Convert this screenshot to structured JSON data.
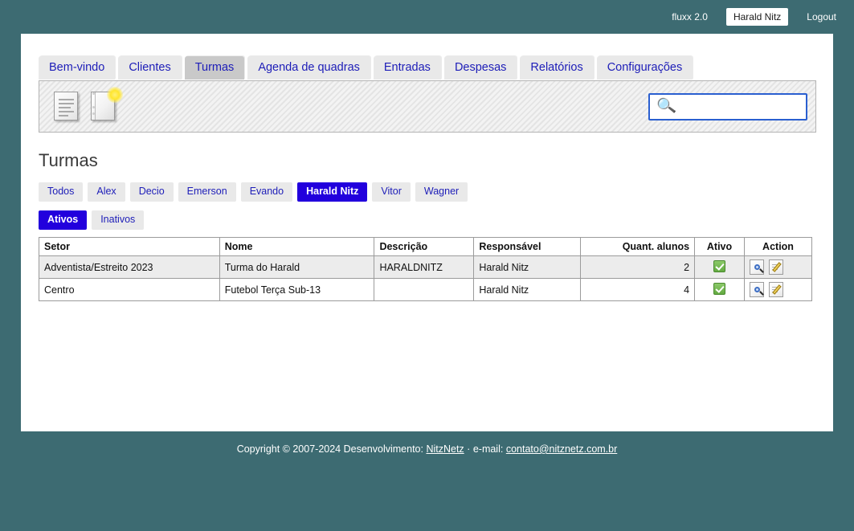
{
  "topbar": {
    "brand": "fluxx 2.0",
    "user": "Harald Nitz",
    "logout": "Logout"
  },
  "tabs": [
    {
      "label": "Bem-vindo",
      "active": false
    },
    {
      "label": "Clientes",
      "active": false
    },
    {
      "label": "Turmas",
      "active": true
    },
    {
      "label": "Agenda de quadras",
      "active": false
    },
    {
      "label": "Entradas",
      "active": false
    },
    {
      "label": "Despesas",
      "active": false
    },
    {
      "label": "Relatórios",
      "active": false
    },
    {
      "label": "Configurações",
      "active": false
    }
  ],
  "toolbar": {
    "list_icon": "document-list-icon",
    "new_icon": "new-document-icon"
  },
  "search": {
    "value": "",
    "placeholder": "",
    "icon": "search-icon"
  },
  "page": {
    "title": "Turmas"
  },
  "filters": {
    "people": [
      {
        "label": "Todos",
        "active": false
      },
      {
        "label": "Alex",
        "active": false
      },
      {
        "label": "Decio",
        "active": false
      },
      {
        "label": "Emerson",
        "active": false
      },
      {
        "label": "Evando",
        "active": false
      },
      {
        "label": "Harald Nitz",
        "active": true
      },
      {
        "label": "Vitor",
        "active": false
      },
      {
        "label": "Wagner",
        "active": false
      }
    ],
    "status": [
      {
        "label": "Ativos",
        "active": true
      },
      {
        "label": "Inativos",
        "active": false
      }
    ]
  },
  "table": {
    "columns": [
      "Setor",
      "Nome",
      "Descrição",
      "Responsável",
      "Quant. alunos",
      "Ativo",
      "Action"
    ],
    "rows": [
      {
        "setor": "Adventista/Estreito 2023",
        "nome": "Turma do Harald",
        "descricao": "HARALDNITZ",
        "responsavel": "Harald Nitz",
        "quant_alunos": "2",
        "ativo": true
      },
      {
        "setor": "Centro",
        "nome": "Futebol Terça Sub-13",
        "descricao": "",
        "responsavel": "Harald Nitz",
        "quant_alunos": "4",
        "ativo": true
      }
    ]
  },
  "footer": {
    "copyright": "Copyright © 2007-2024 Desenvolvimento:",
    "dev_link": "NitzNetz",
    "separator": "·",
    "email_label": "e-mail:",
    "email_link": "contato@nitznetz.com.br"
  },
  "colors": {
    "background": "#3d6b72",
    "accent": "#2200dd",
    "link": "#1d1db8",
    "active_check": "#63ab41",
    "focus_ring": "#2a5fd0"
  }
}
